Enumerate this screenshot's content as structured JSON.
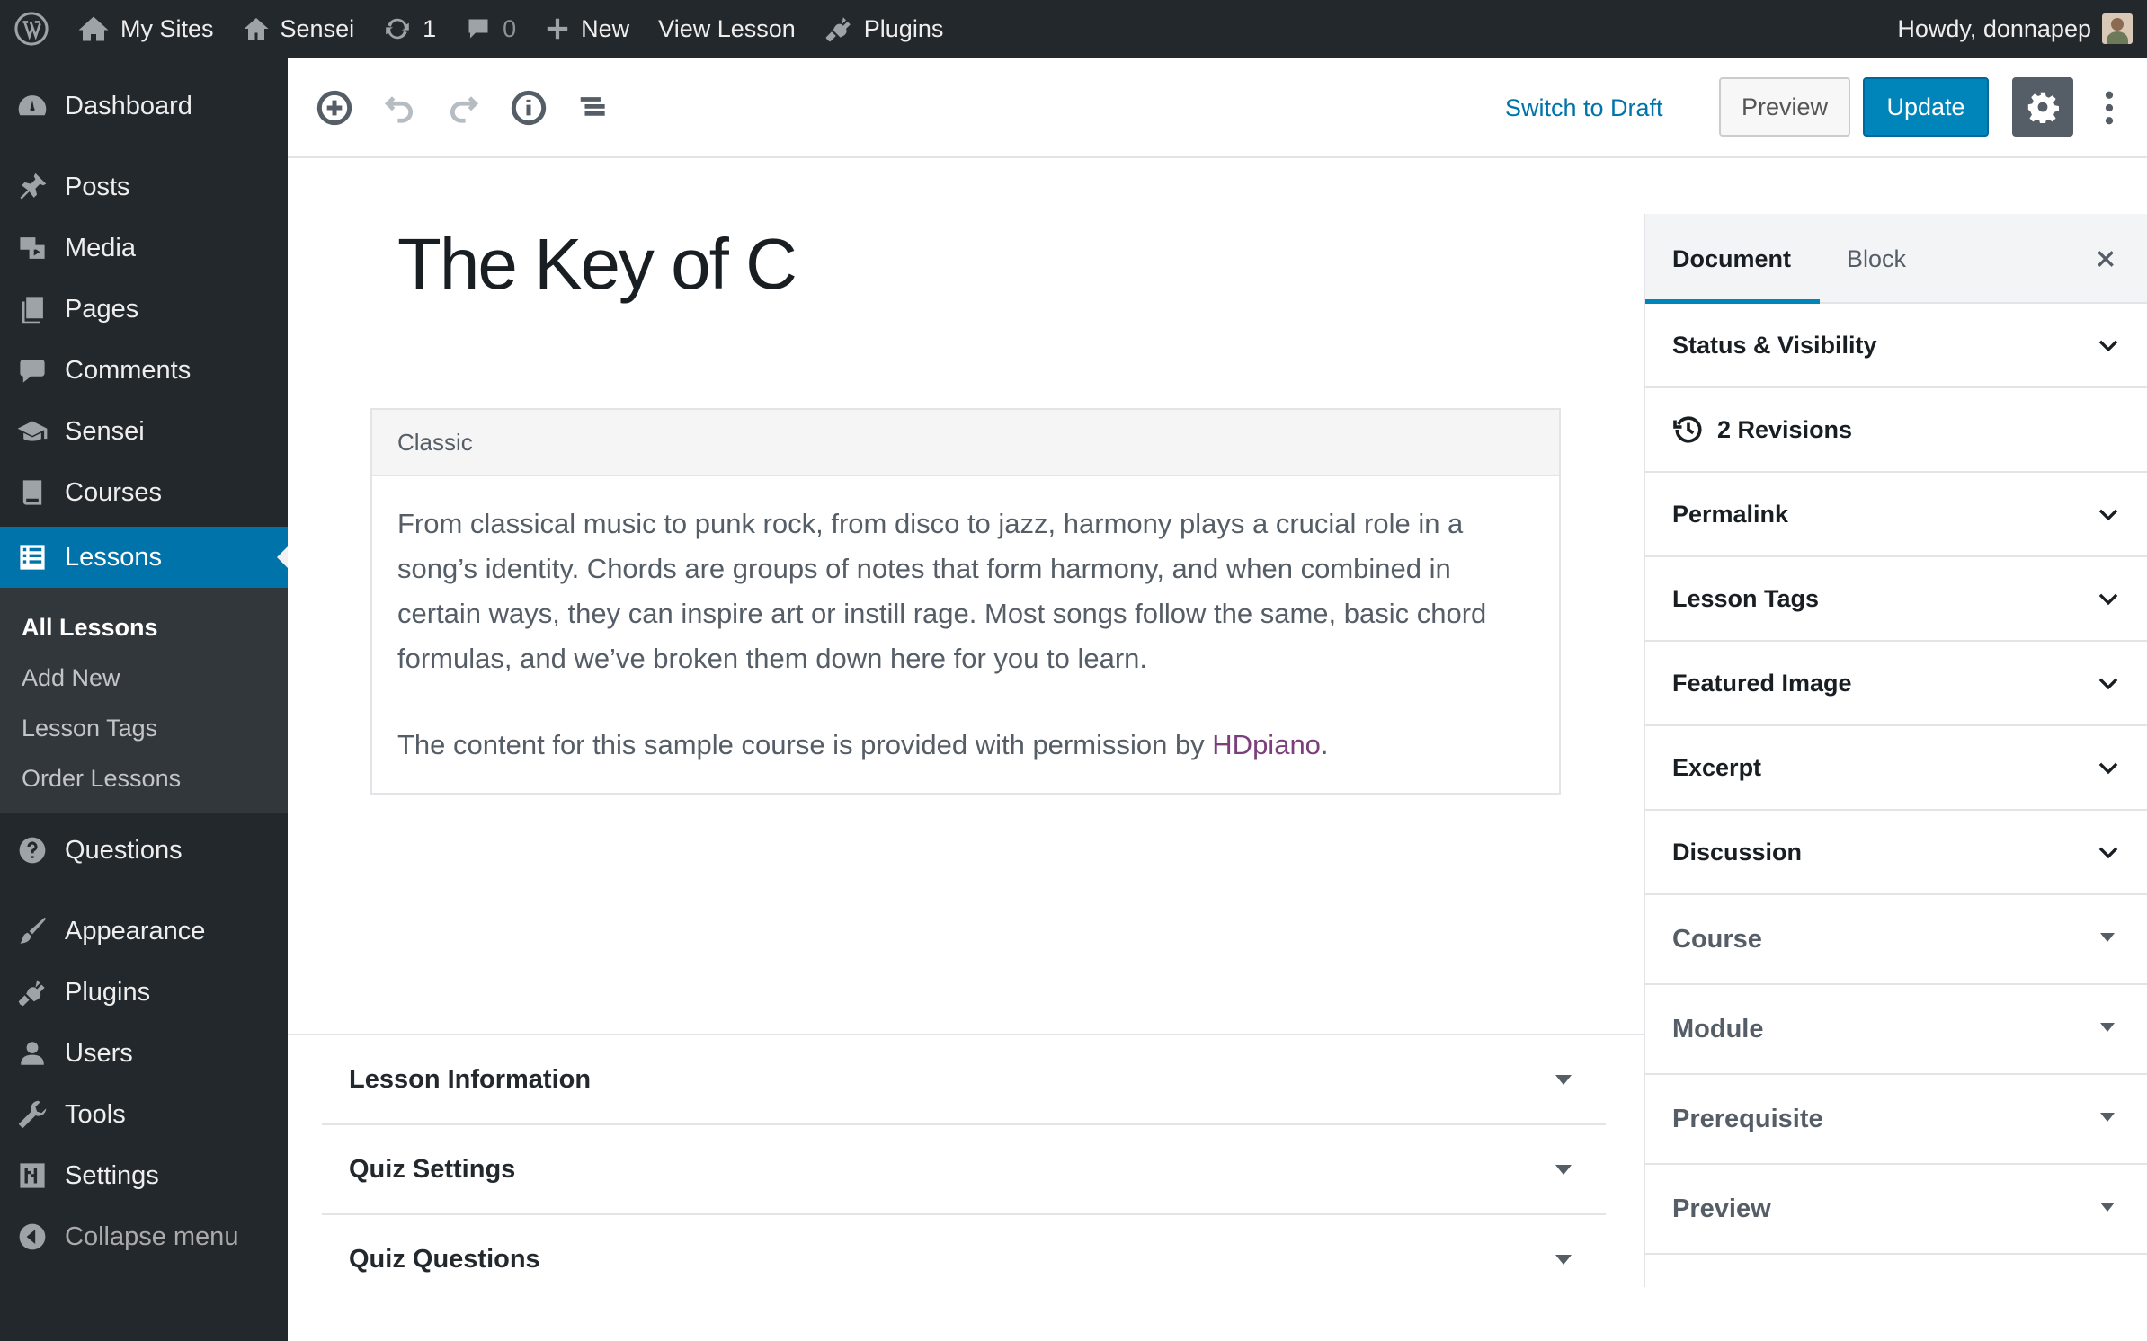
{
  "admin_bar": {
    "my_sites": "My Sites",
    "site_name": "Sensei",
    "updates_count": "1",
    "comments_count": "0",
    "new_label": "New",
    "view_lesson": "View Lesson",
    "plugins": "Plugins",
    "greeting": "Howdy, donnapep"
  },
  "sidebar": {
    "items": [
      {
        "label": "Dashboard",
        "icon": "dashboard-icon"
      },
      {
        "label": "Posts",
        "icon": "pin-icon"
      },
      {
        "label": "Media",
        "icon": "media-icon"
      },
      {
        "label": "Pages",
        "icon": "pages-icon"
      },
      {
        "label": "Comments",
        "icon": "comment-icon"
      },
      {
        "label": "Sensei",
        "icon": "graduation-cap-icon"
      },
      {
        "label": "Courses",
        "icon": "book-icon"
      },
      {
        "label": "Lessons",
        "icon": "list-icon",
        "current": true
      },
      {
        "label": "Questions",
        "icon": "question-icon"
      },
      {
        "label": "Appearance",
        "icon": "brush-icon"
      },
      {
        "label": "Plugins",
        "icon": "plugin-icon"
      },
      {
        "label": "Users",
        "icon": "user-icon"
      },
      {
        "label": "Tools",
        "icon": "wrench-icon"
      },
      {
        "label": "Settings",
        "icon": "settings-icon"
      },
      {
        "label": "Collapse menu",
        "icon": "collapse-icon"
      }
    ],
    "submenu": [
      "All Lessons",
      "Add New",
      "Lesson Tags",
      "Order Lessons"
    ]
  },
  "toolbar": {
    "switch_to_draft": "Switch to Draft",
    "preview": "Preview",
    "update": "Update"
  },
  "post": {
    "title": "The Key of C",
    "block_label": "Classic",
    "paragraph1": "From classical music to punk rock, from disco to jazz, harmony plays a crucial role in a song’s identity. Chords are groups of notes that form harmony, and when combined in certain ways, they can inspire art or instill rage. Most songs follow the same, basic chord formulas, and we’ve broken them down here for you to learn.",
    "paragraph2_prefix": "The content for this sample course is provided with permission by ",
    "paragraph2_link": "HDpiano",
    "paragraph2_suffix": "."
  },
  "metaboxes": [
    "Lesson Information",
    "Quiz Settings",
    "Quiz Questions"
  ],
  "settings_sidebar": {
    "tabs": [
      "Document",
      "Block"
    ],
    "panels": [
      "Status & Visibility",
      "2 Revisions",
      "Permalink",
      "Lesson Tags",
      "Featured Image",
      "Excerpt",
      "Discussion"
    ],
    "meta_panels": [
      "Course",
      "Module",
      "Prerequisite",
      "Preview"
    ]
  },
  "colors": {
    "admin_dark": "#23282d",
    "accent_blue": "#0073aa",
    "update_blue": "#0085ba",
    "link_purple": "#7b3f7b"
  }
}
